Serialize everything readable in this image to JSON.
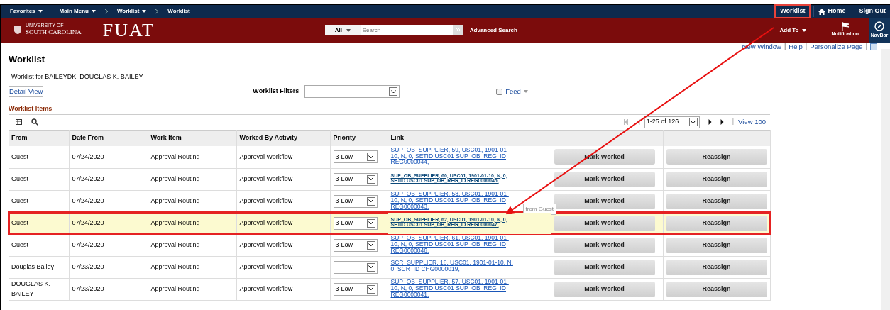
{
  "nav_bar": {
    "menus": [
      {
        "label": "Favorites",
        "dropdown": true,
        "separator_before": false
      },
      {
        "label": "Main Menu",
        "dropdown": true,
        "separator_before": false
      },
      {
        "label": "Worklist",
        "dropdown": true,
        "separator_before": true
      },
      {
        "label": "Worklist",
        "dropdown": false,
        "separator_before": true
      }
    ],
    "right_links": [
      {
        "label": "Worklist",
        "annotated": true
      },
      {
        "label": "Home",
        "annotated": false
      },
      {
        "label": "Sign Out",
        "annotated": false
      }
    ]
  },
  "banner": {
    "logo_text": "UNIVERSITY OF",
    "logo_name": "SOUTH CAROLINA",
    "app_name": "FUAT",
    "search_scope": "All",
    "search_placeholder": "Search",
    "advanced_search": "Advanced Search",
    "add_to": "Add To",
    "notification": "Notification",
    "navbar": "NavBar"
  },
  "page_links": [
    {
      "label": "New Window",
      "separator": "|"
    },
    {
      "label": "Help",
      "separator": "|"
    },
    {
      "label": "Personalize Page",
      "separator": "|"
    }
  ],
  "title": "Worklist",
  "subtitle": "Worklist for BAILEYDK: DOUGLAS K. BAILEY",
  "detail_view": "Detail View",
  "filters_label": "Worklist Filters",
  "feed": {
    "label": "Feed",
    "checked": false
  },
  "section_title": "Worklist Items",
  "pager": {
    "range": "1-25 of 126",
    "separator": "|",
    "view_all": "View 100"
  },
  "table": {
    "columns": [
      "From",
      "Date From",
      "Work Item",
      "Worked By Activity",
      "Priority",
      "Link"
    ],
    "rows": [
      {
        "from": "Guest",
        "date": "07/24/2020",
        "work_item": "Approval Routing",
        "activity": "Approval Workflow",
        "priority": "3-Low",
        "link": "SUP_OB_SUPPLIER, 59, USC01, 1901-01-10, N, 0, SETID USC01 SUP_OB_REG_ID REG0000044,",
        "visited": false,
        "selected": false,
        "annotated": false,
        "mark": "Mark Worked",
        "reassign": "Reassign"
      },
      {
        "from": "Guest",
        "date": "07/24/2020",
        "work_item": "Approval Routing",
        "activity": "Approval Workflow",
        "priority": "3-Low",
        "link": "SUP_OB_SUPPLIER, 60, USC01, 1901-01-10, N, 0, SETID USC01 SUP_OB_REG_ID REG0000045,",
        "visited": true,
        "selected": false,
        "annotated": false,
        "mark": "Mark Worked",
        "reassign": "Reassign"
      },
      {
        "from": "Guest",
        "date": "07/24/2020",
        "work_item": "Approval Routing",
        "activity": "Approval Workflow",
        "priority": "3-Low",
        "link": "SUP_OB_SUPPLIER, 58, USC01, 1901-01-10, N, 0, SETID USC01 SUP_OB_REG_ID REG0000043,",
        "visited": false,
        "selected": false,
        "annotated": false,
        "mark": "Mark Worked",
        "reassign": "Reassign",
        "tooltip": "from Guest"
      },
      {
        "from": "Guest",
        "date": "07/24/2020",
        "work_item": "Approval Routing",
        "activity": "Approval Workflow",
        "priority": "3-Low",
        "link": "SUP_OB_SUPPLIER, 62, USC01, 1901-01-10, N, 0, SETID USC01 SUP_OB_REG_ID REG0000047,",
        "visited": true,
        "selected": true,
        "annotated": true,
        "mark": "Mark Worked",
        "reassign": "Reassign"
      },
      {
        "from": "Guest",
        "date": "07/24/2020",
        "work_item": "Approval Routing",
        "activity": "Approval Workflow",
        "priority": "3-Low",
        "link": "SUP_OB_SUPPLIER, 61, USC01, 1901-01-10, N, 0, SETID USC01 SUP_OB_REG_ID REG0000046,",
        "visited": false,
        "selected": false,
        "annotated": false,
        "mark": "Mark Worked",
        "reassign": "Reassign"
      },
      {
        "from": "Douglas Bailey",
        "date": "07/23/2020",
        "work_item": "Approval Routing",
        "activity": "Approval Workflow",
        "link": "SCR_SUPPLIER, 18, USC01, 1901-01-10, N, 0, SCR_ID CHG0000019,",
        "visited": false,
        "selected": false,
        "annotated": false,
        "mark": "Mark Worked",
        "reassign": "Reassign"
      },
      {
        "from": "DOUGLAS K. BAILEY",
        "date": "07/23/2020",
        "work_item": "Approval Routing",
        "activity": "Approval Workflow",
        "priority": "3-Low",
        "link": "SUP_OB_SUPPLIER, 57, USC01, 1901-01-10, N, 0, SETID USC01 SUP_OB_REG_ID REG0000041,",
        "visited": false,
        "selected": false,
        "annotated": false,
        "mark": "Mark Worked",
        "reassign": "Reassign"
      }
    ]
  }
}
